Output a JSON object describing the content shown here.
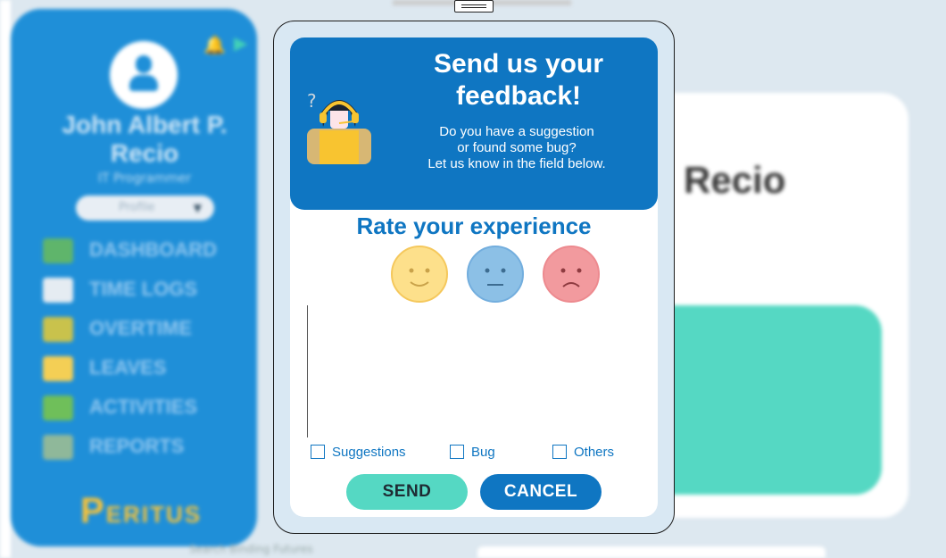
{
  "sidebar": {
    "user_name": "John Albert P. Recio",
    "user_role": "IT Programmer",
    "profile_label": "Profile",
    "nav": [
      {
        "label": "DASHBOARD",
        "icon": "chart-icon"
      },
      {
        "label": "TIME LOGS",
        "icon": "clock-icon"
      },
      {
        "label": "OVERTIME",
        "icon": "overtime-icon"
      },
      {
        "label": "LEAVES",
        "icon": "leave-icon"
      },
      {
        "label": "ACTIVITIES",
        "icon": "activities-icon"
      },
      {
        "label": "REPORTS",
        "icon": "reports-icon"
      }
    ],
    "logo_text": "ERITUS"
  },
  "background": {
    "name_fragment": "Recio",
    "search_placeholder": "Search Binding Futures"
  },
  "modal": {
    "title": "Send us your feedback!",
    "desc": [
      "Do you have a suggestion",
      "or found some bug?",
      "Let us know in the field below."
    ],
    "rate_title": "Rate your experience",
    "faces": [
      {
        "name": "happy",
        "color": "#fce08a"
      },
      {
        "name": "neutral",
        "color": "#8cc0e6"
      },
      {
        "name": "sad",
        "color": "#f29a9e"
      }
    ],
    "textarea_value": "",
    "checkboxes": [
      {
        "label": "Suggestions",
        "checked": false
      },
      {
        "label": "Bug",
        "checked": false
      },
      {
        "label": "Others",
        "checked": false
      }
    ],
    "send_label": "SEND",
    "cancel_label": "CANCEL"
  },
  "colors": {
    "primary": "#0f76c2",
    "accent": "#55d8c3",
    "sidebar": "#1f8fd8"
  }
}
